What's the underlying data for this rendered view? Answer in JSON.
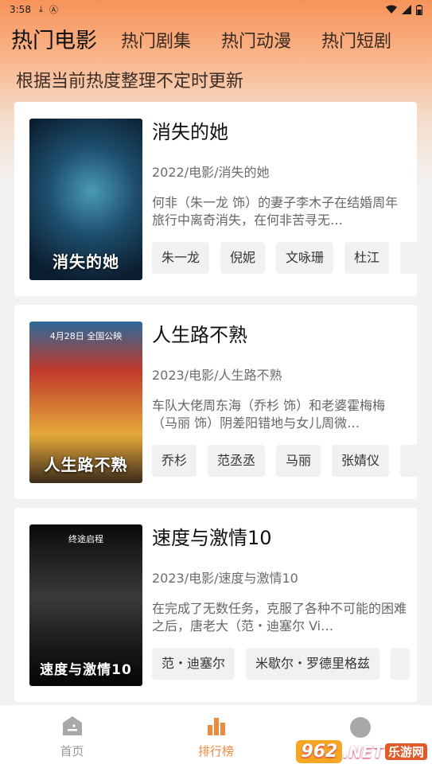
{
  "status_bar": {
    "time": "3:58"
  },
  "tabs": [
    "热门电影",
    "热门剧集",
    "热门动漫",
    "热门短剧"
  ],
  "subtitle": "根据当前热度整理不定时更新",
  "cards": [
    {
      "title": "消失的她",
      "meta": "2022/电影/消失的她",
      "desc": "何非（朱一龙 饰）的妻子李木子在结婚周年旅行中离奇消失，在何非苦寻无…",
      "cast": [
        "朱一龙",
        "倪妮",
        "文咏珊",
        "杜江"
      ],
      "poster_top": "",
      "poster_text": "消失的她",
      "poster_colors": [
        "#0e2a44",
        "#2f6f8c",
        "#0b1c2e"
      ]
    },
    {
      "title": "人生路不熟",
      "meta": "2023/电影/人生路不熟",
      "desc": "车队大佬周东海（乔杉 饰）和老婆霍梅梅（马丽 饰）阴差阳错地与女儿周微…",
      "cast": [
        "乔杉",
        "范丞丞",
        "马丽",
        "张婧仪"
      ],
      "poster_top": "4月28日 全国公映",
      "poster_text": "人生路不熟",
      "poster_colors": [
        "#c0392b",
        "#e5a93a",
        "#2b6a9b"
      ]
    },
    {
      "title": "速度与激情10",
      "meta": "2023/电影/速度与激情10",
      "desc": "在完成了无数任务，克服了各种不可能的困难之后，唐老大（范・迪塞尔 Vi…",
      "cast": [
        "范・迪塞尔",
        "米歇尔・罗德里格兹"
      ],
      "poster_top": "终途启程",
      "poster_text": "速度与激情10",
      "poster_colors": [
        "#111111",
        "#3a3a3a",
        "#0a0a0a"
      ]
    }
  ],
  "nav": {
    "home": "首页",
    "ranking": "排行榜"
  },
  "watermark": {
    "badge": "962",
    "suffix": ".NET",
    "text": "乐游网"
  },
  "colors": {
    "accent": "#f08a3c"
  }
}
